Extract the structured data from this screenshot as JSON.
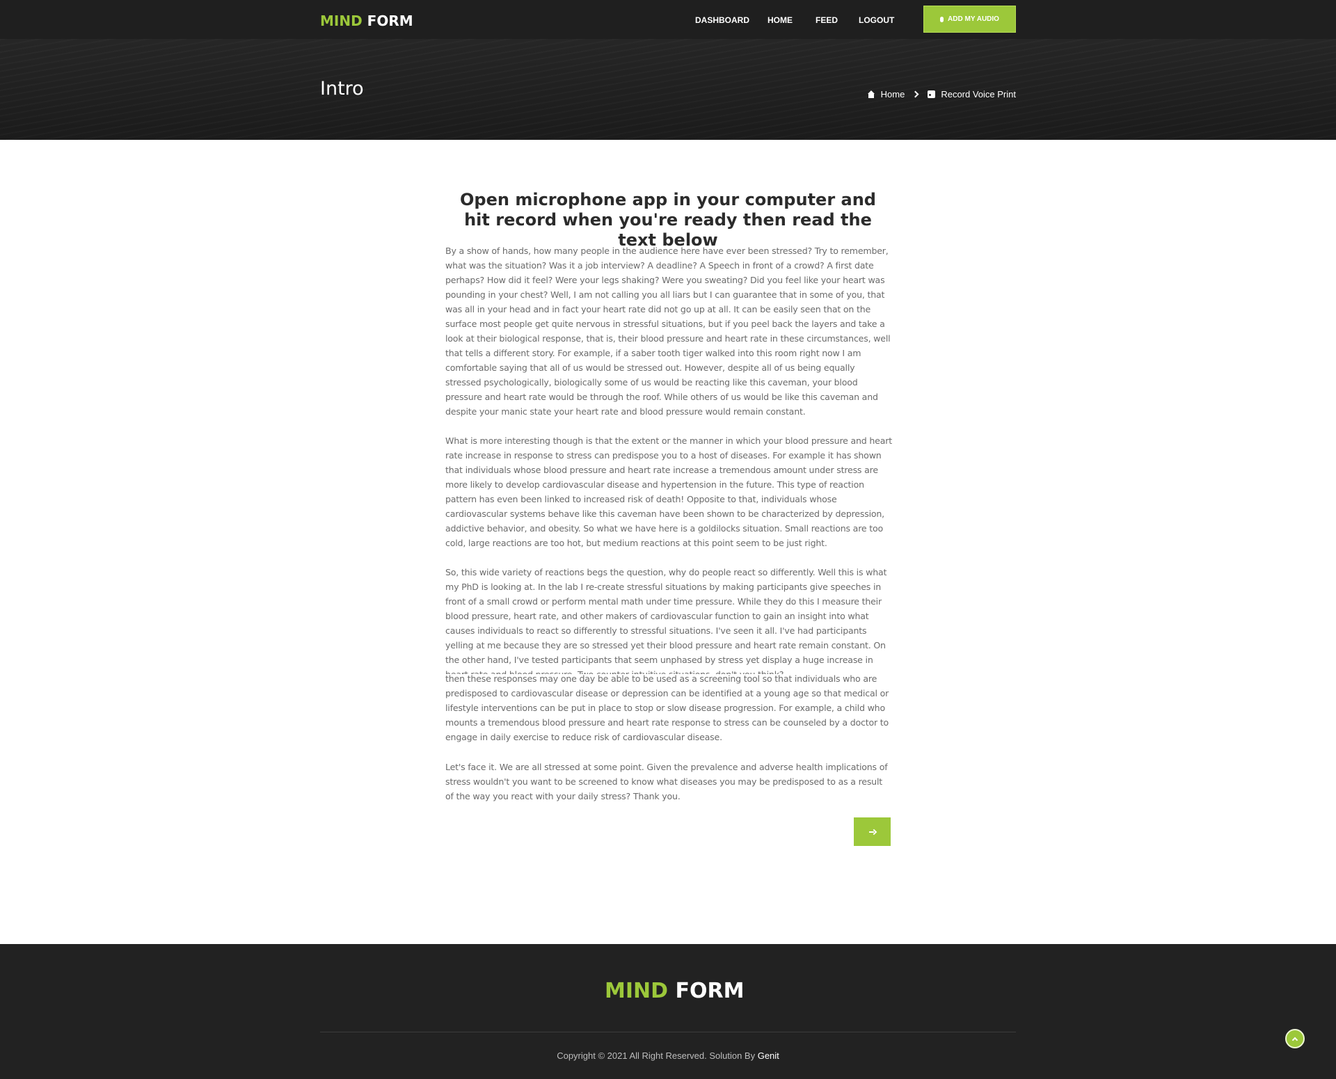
{
  "header": {
    "logo": {
      "part1": "MIND",
      "part2": "FORM"
    },
    "nav": [
      "DASHBOARD",
      "HOME",
      "FEED",
      "LOGOUT"
    ],
    "cta_label": "ADD MY AUDIO"
  },
  "hero": {
    "title": "Intro",
    "breadcrumb": {
      "home": "Home",
      "current": "Record Voice Print"
    }
  },
  "main": {
    "title": "Open microphone app in your computer and hit record when you're ready then read the text below",
    "paragraphs": [
      "By a show of hands, how many people in the audience here have ever been stressed? Try to remember, what was the situation? Was it a job interview? A deadline? A Speech in front of a crowd? A first date perhaps? How did it feel? Were your legs shaking? Were you sweating? Did you feel like your heart was pounding in your chest? Well, I am not calling you all liars but I can guarantee that in some of you, that was all in your head and in fact your heart rate did not go up at all. It can be easily seen that on the surface most people get quite nervous in stressful situations, but if you peel back the layers and take a look at their biological response, that is, their blood pressure and heart rate in these circumstances, well that tells a different story. For example, if a saber tooth tiger walked into this room right now I am comfortable saying that all of us would be stressed out. However, despite all of us being equally stressed psychologically, biologically some of us would be reacting like this caveman, your blood pressure and heart rate would be through the roof. While others of us would be like this caveman and despite your manic state your heart rate and blood pressure would remain constant.",
      "What is more interesting though is that the extent or the manner in which your blood pressure and heart rate increase in response to stress can predispose you to a host of diseases. For example it has shown that individuals whose blood pressure and heart rate increase a tremendous amount under stress are more likely to develop cardiovascular disease and hypertension in the future. This type of reaction pattern has even been linked to increased risk of death! Opposite to that, individuals whose cardiovascular systems behave like this caveman have been shown to be characterized by depression, addictive behavior, and obesity. So what we have here is a goldilocks situation. Small reactions are too cold, large reactions are too hot, but medium reactions at this point seem to be just right.",
      "So, this wide variety of reactions begs the question, why do people react so differently. Well this is what my PhD is looking at. In the lab I re-create stressful situations by making participants give speeches in front of a small crowd or perform mental math under time pressure. While they do this I measure their blood pressure, heart rate, and other makers of cardiovascular function to gain an insight into what causes individuals to react so differently to stressful situations. I've seen it all. I've had participants yelling at me because they are so stressed yet their blood pressure and heart rate remain constant. On the other hand, I've tested participants that seem unphased by stress yet display a huge increase in heart rate and blood pressure. Two counter-intuitive situations, don't you think?",
      "then these responses may one day be able to be used as a screening tool so that individuals who are predisposed to cardiovascular disease or depression can be identified at a young age so that medical or lifestyle interventions can be put in place to stop or slow disease progression. For example, a child who mounts a tremendous blood pressure and heart rate response to stress can be counseled by a doctor to engage in daily exercise to reduce risk of cardiovascular disease.",
      "Let's face it. We are all stressed at some point. Given the prevalence and adverse health implications of stress wouldn't you want to be screened to know what diseases you may be predisposed to as a result of the way you react with your daily stress? Thank you."
    ]
  },
  "footer": {
    "logo": {
      "part1": "MIND",
      "part2": "FORM"
    },
    "copyright": "Copyright © 2021 All Right Reserved. Solution By ",
    "author": "Genit"
  },
  "colors": {
    "accent": "#9cc83a",
    "dark": "#1f1f1f",
    "footer": "#222222",
    "text": "#6b6b6b"
  }
}
